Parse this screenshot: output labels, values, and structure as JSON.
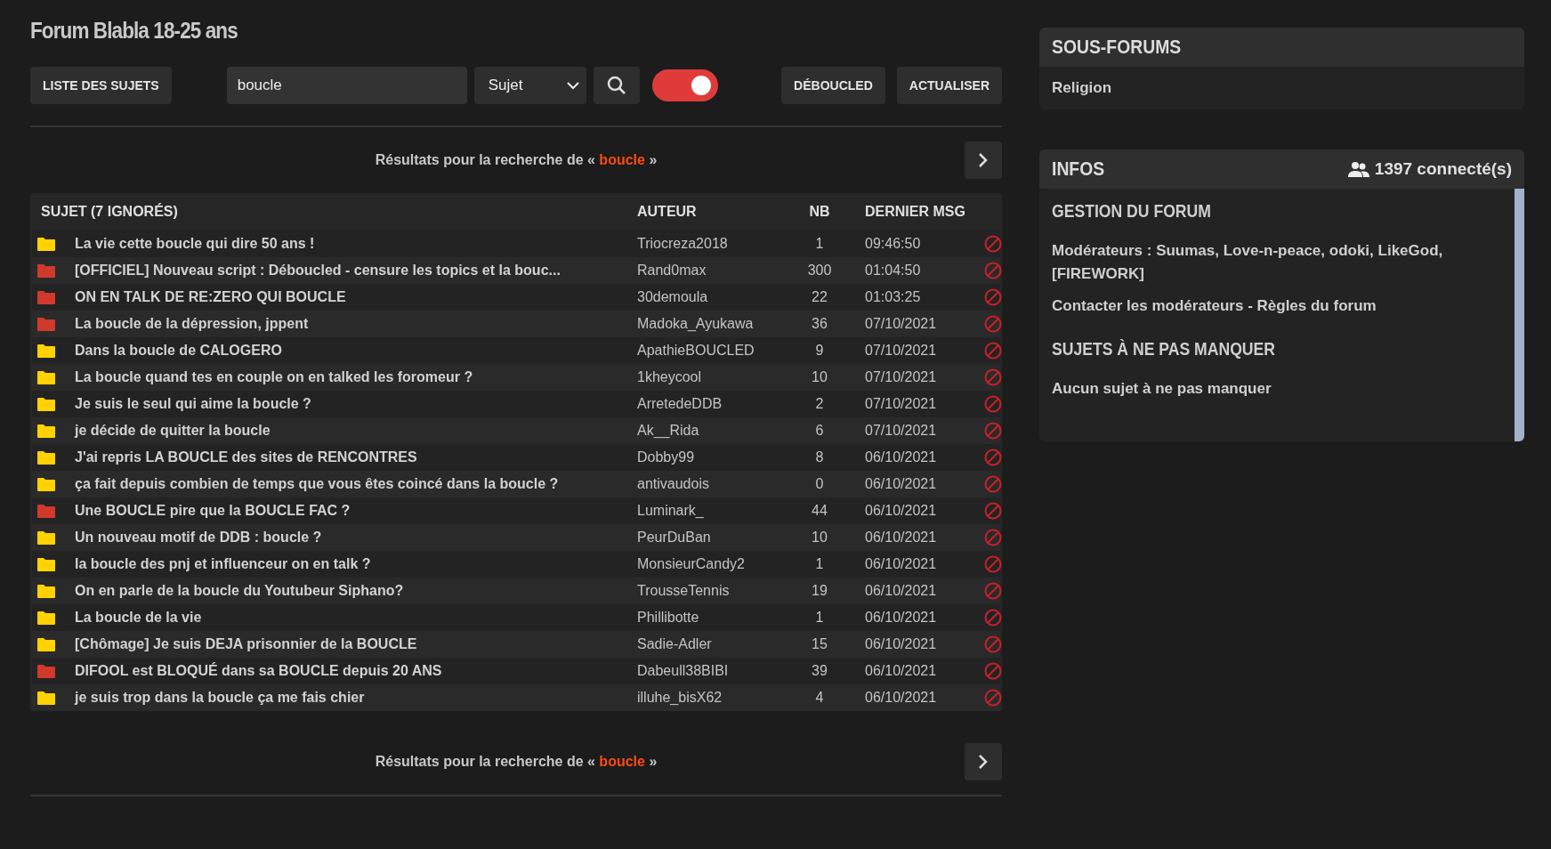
{
  "title": "Forum Blabla 18-25 ans",
  "toolbar": {
    "list_button": "LISTE DES SUJETS",
    "search": {
      "value": "boucle"
    },
    "filter": {
      "value": "Sujet"
    },
    "toggle": {
      "on": true
    },
    "buttons": [
      "DÉBOUCLED",
      "ACTUALISER"
    ]
  },
  "results_top": {
    "prefix": "Résultats pour la recherche de «",
    "query": "boucle",
    "suffix": "»"
  },
  "table": {
    "columns": [
      "SUJET (7 IGNORÉS)",
      "AUTEUR",
      "NB",
      "DERNIER MSG"
    ],
    "rows": [
      {
        "title": "La vie cette boucle qui dire 50 ans !",
        "author": "Triocreza2018",
        "nb": "1",
        "last": "09:46:50",
        "color": "#ffd200"
      },
      {
        "title": "[OFFICIEL] Nouveau script : Déboucled - censure les topics et la bouc...",
        "author": "Rand0max",
        "nb": "300",
        "last": "01:04:50",
        "color": "#d0392b"
      },
      {
        "title": "ON EN TALK DE RE:ZERO QUI BOUCLE",
        "author": "30demoula",
        "nb": "22",
        "last": "01:03:25",
        "color": "#d0392b"
      },
      {
        "title": "La boucle de la dépression, jppent",
        "author": "Madoka_Ayukawa",
        "nb": "36",
        "last": "07/10/2021",
        "color": "#d0392b"
      },
      {
        "title": "Dans la boucle de CALOGERO",
        "author": "ApathieBOUCLED",
        "nb": "9",
        "last": "07/10/2021",
        "color": "#ffd200"
      },
      {
        "title": "La boucle quand tes en couple on en talked les foromeur ?",
        "author": "1kheycool",
        "nb": "10",
        "last": "07/10/2021",
        "color": "#ffd200"
      },
      {
        "title": "Je suis le seul qui aime la boucle ?",
        "author": "ArretedeDDB",
        "nb": "2",
        "last": "07/10/2021",
        "color": "#ffd200"
      },
      {
        "title": "je décide de quitter la boucle",
        "author": "Ak__Rida",
        "nb": "6",
        "last": "07/10/2021",
        "color": "#ffd200"
      },
      {
        "title": "J'ai repris LA BOUCLE des sites de RENCONTRES",
        "author": "Dobby99",
        "nb": "8",
        "last": "06/10/2021",
        "color": "#ffd200"
      },
      {
        "title": "ça fait depuis combien de temps que vous êtes coincé dans la boucle ?",
        "author": "antivaudois",
        "nb": "0",
        "last": "06/10/2021",
        "color": "#ffd200"
      },
      {
        "title": "Une BOUCLE pire que la BOUCLE FAC ?",
        "author": "Luminark_",
        "nb": "44",
        "last": "06/10/2021",
        "color": "#d0392b"
      },
      {
        "title": "Un nouveau motif de DDB : boucle ?",
        "author": "PeurDuBan",
        "nb": "10",
        "last": "06/10/2021",
        "color": "#ffd200"
      },
      {
        "title": "la boucle des pnj et influenceur on en talk ?",
        "author": "MonsieurCandy2",
        "nb": "1",
        "last": "06/10/2021",
        "color": "#ffd200"
      },
      {
        "title": "On en parle de la boucle du Youtubeur Siphano?",
        "author": "TrousseTennis",
        "nb": "19",
        "last": "06/10/2021",
        "color": "#ffd200"
      },
      {
        "title": "La boucle de la vie",
        "author": "Phillibotte",
        "nb": "1",
        "last": "06/10/2021",
        "color": "#ffd200"
      },
      {
        "title": "[Chômage] Je suis DEJA prisonnier de la BOUCLE",
        "author": "Sadie-Adler",
        "nb": "15",
        "last": "06/10/2021",
        "color": "#ffd200"
      },
      {
        "title": "DIFOOL est BLOQUÉ dans sa BOUCLE depuis 20 ANS",
        "author": "Dabeull38BIBI",
        "nb": "39",
        "last": "06/10/2021",
        "color": "#d0392b"
      },
      {
        "title": "je suis trop dans la boucle ça me fais chier",
        "author": "illuhe_bisX62",
        "nb": "4",
        "last": "06/10/2021",
        "color": "#ffd200"
      }
    ]
  },
  "results_bottom": {
    "prefix": "Résultats pour la recherche de «",
    "query": "boucle",
    "suffix": "»"
  },
  "subforums": {
    "title": "SOUS-FORUMS",
    "items": [
      "Religion"
    ]
  },
  "infos": {
    "title": "INFOS",
    "connected": "1397 connecté(s)",
    "sections": [
      {
        "heading": "GESTION DU FORUM",
        "lines": [
          "Modérateurs : Suumas, Love-n-peace, odoki, LikeGod, [FIREWORK]",
          "Contacter les modérateurs - Règles du forum"
        ]
      },
      {
        "heading": "SUJETS À NE PAS MANQUER",
        "lines": [
          "Aucun sujet à ne pas manquer"
        ]
      }
    ]
  }
}
